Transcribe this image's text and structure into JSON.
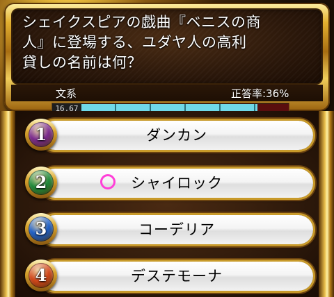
{
  "question": {
    "lines": [
      "シェイクスピアの戯曲『ベニスの商",
      "人』に登場する、ユダヤ人の高利",
      "貸しの名前は何？"
    ],
    "genre": "文系",
    "correct_rate_label": "正答率:36%"
  },
  "timer": {
    "value": "16.67",
    "fill_fraction": 0.85
  },
  "answers": [
    {
      "number": "1",
      "label": "ダンカン",
      "color": "#7a2a8e",
      "selected": false
    },
    {
      "number": "2",
      "label": "シャイロック",
      "color": "#1f8a3a",
      "selected": true
    },
    {
      "number": "3",
      "label": "コーデリア",
      "color": "#1d5fc8",
      "selected": false
    },
    {
      "number": "4",
      "label": "デステモーナ",
      "color": "#d2461a",
      "selected": false
    }
  ],
  "colors": {
    "selection_mark": "#ff3fd8",
    "timer_fill": "#6fd8e8",
    "gold": "#e3b030"
  }
}
